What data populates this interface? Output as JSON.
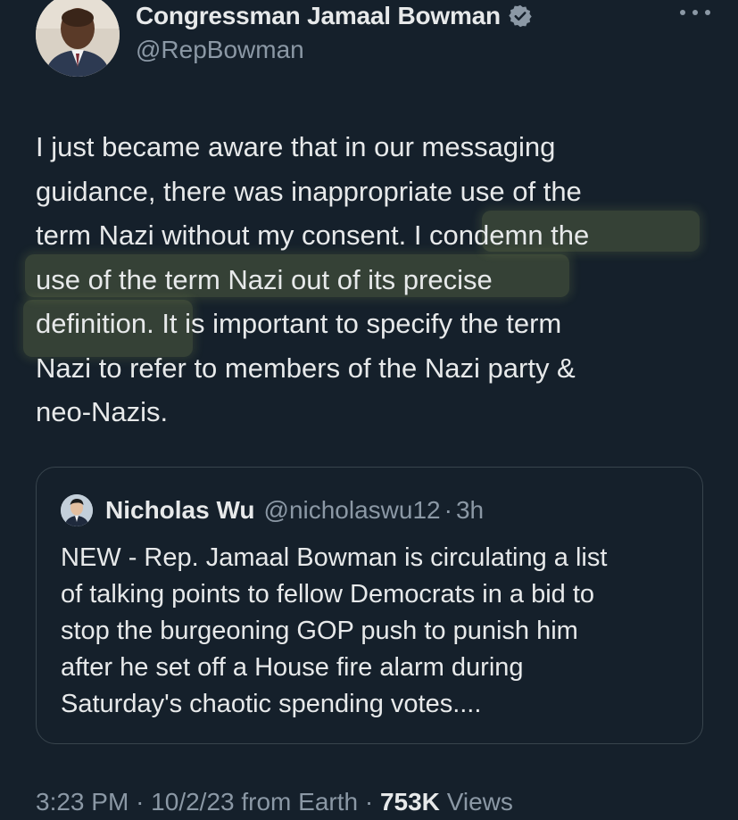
{
  "author": {
    "display_name": "Congressman Jamaal Bowman",
    "handle": "@RepBowman",
    "verified_icon": "verified-badge-icon",
    "more_icon": "more-options-icon"
  },
  "tweet": {
    "lines": [
      "I just became aware that in our messaging",
      "guidance, there was inappropriate use of the",
      "term Nazi without my consent. I condemn the",
      "use of the term Nazi out of its precise",
      "definition. It is important to specify the term",
      "Nazi to refer to members of the Nazi party &",
      "neo-Nazis."
    ]
  },
  "quote": {
    "display_name": "Nicholas Wu",
    "handle": "@nicholaswu12",
    "separator": "·",
    "time": "3h",
    "lines": [
      "NEW - Rep. Jamaal Bowman is circulating a list",
      "of talking points to fellow Democrats in a bid to",
      "stop the burgeoning GOP push to punish him",
      "after he set off a House fire alarm during",
      "Saturday's chaotic spending votes...."
    ]
  },
  "meta": {
    "time": "3:23 PM",
    "date": "10/2/23",
    "source": "from Earth",
    "separator": "·",
    "views_count": "753K",
    "views_label": "Views"
  },
  "colors": {
    "background": "#15202b",
    "text_primary": "#e7e9ea",
    "text_secondary": "#8b98a5",
    "verified_blue": "#8b98a5",
    "border": "#38444d",
    "highlight": "#d6e86e"
  }
}
